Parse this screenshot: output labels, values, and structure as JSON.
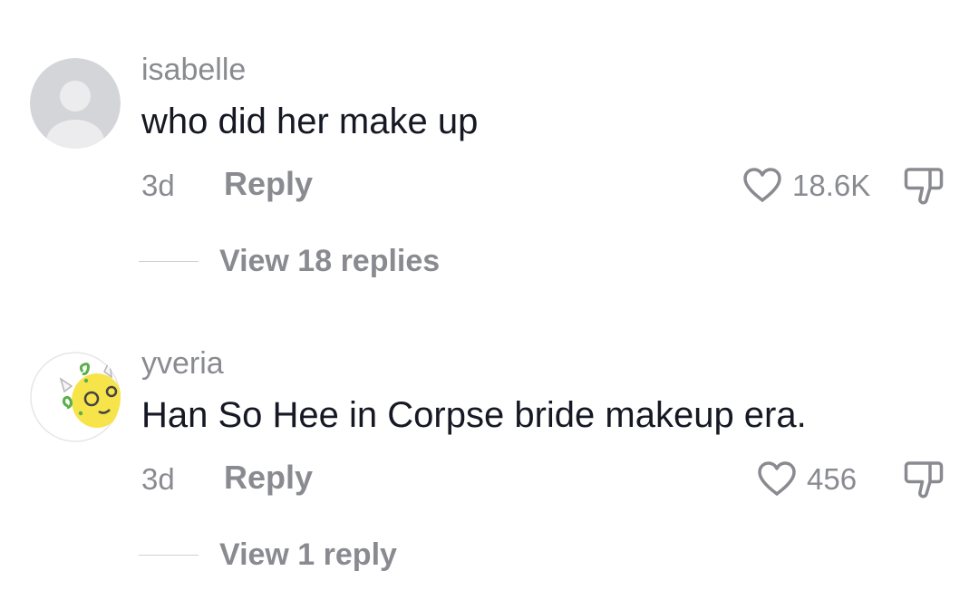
{
  "comments": [
    {
      "username": "isabelle",
      "text": "who did her make up",
      "time": "3d",
      "reply_label": "Reply",
      "like_count": "18.6K",
      "view_replies": "View 18 replies",
      "avatar": "default-avatar-icon"
    },
    {
      "username": "yveria",
      "text": "Han So Hee in Corpse bride makeup era.",
      "time": "3d",
      "reply_label": "Reply",
      "like_count": "456",
      "view_replies": "View 1 reply",
      "avatar": "yellow-cartoon-avatar"
    }
  ],
  "colors": {
    "text_primary": "#161823",
    "text_secondary": "#8a8b91",
    "avatar_placeholder": "#d4d5d8",
    "thread_line": "#cfd0d3"
  }
}
